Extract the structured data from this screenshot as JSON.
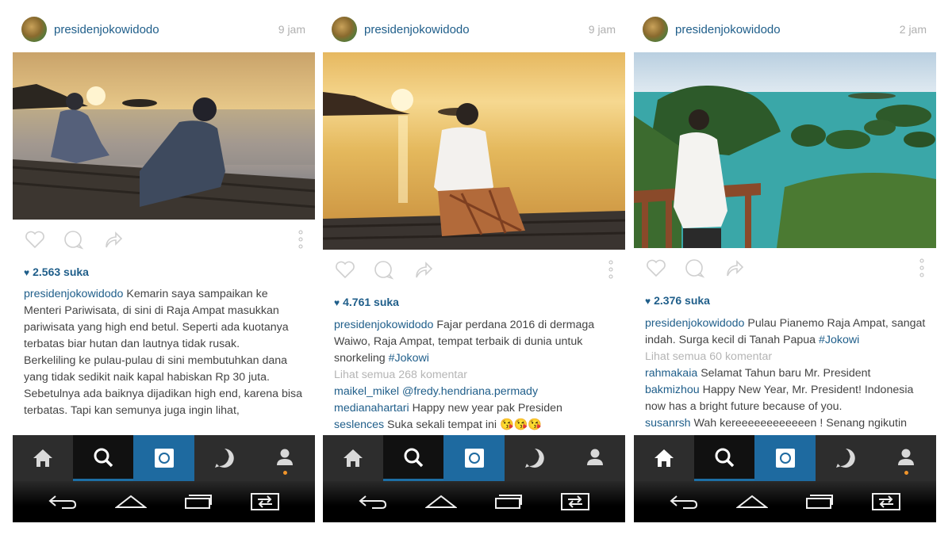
{
  "posts": [
    {
      "username": "presidenjokowidodo",
      "time": "9 jam",
      "likes": "2.563 suka",
      "caption": "Kemarin saya sampaikan ke Menteri Pariwisata, di sini di Raja Ampat masukkan pariwisata yang high end betul. Seperti ada kuotanya terbatas biar hutan dan lautnya tidak rusak.",
      "caption2": "Berkeliling ke pulau-pulau di sini membutuhkan dana yang tidak sedikit naik kapal habiskan Rp 30 juta. Sebetulnya ada baiknya dijadikan high end, karena bisa terbatas. Tapi kan semunya juga ingin lihat,"
    },
    {
      "username": "presidenjokowidodo",
      "time": "9 jam",
      "likes": "4.761 suka",
      "caption": "Fajar perdana 2016 di dermaga Waiwo, Raja Ampat, tempat terbaik di dunia untuk snorkeling",
      "hashtag": "#Jokowi",
      "see_all": "Lihat semua 268 komentar",
      "comments": [
        {
          "user": "maikel_mikel",
          "text": "@fredy.hendriana.permady"
        },
        {
          "user": "medianahartari",
          "text": "Happy new year pak Presiden"
        },
        {
          "user": "seslences",
          "text": "Suka sekali tempat ini 😘😘😘"
        }
      ]
    },
    {
      "username": "presidenjokowidodo",
      "time": "2 jam",
      "likes": "2.376 suka",
      "caption": "Pulau Pianemo Raja Ampat, sangat indah. Surga kecil di Tanah Papua",
      "hashtag": "#Jokowi",
      "see_all": "Lihat semua 60 komentar",
      "comments": [
        {
          "user": "rahmakaia",
          "text": "Selamat Tahun baru Mr. President"
        },
        {
          "user": "bakmizhou",
          "text": "Happy New Year, Mr. President! Indonesia now has a bright future because of you."
        },
        {
          "user": "susanrsh",
          "text": "Wah kereeeeeeeeeeeen ! Senang ngikutin"
        }
      ]
    }
  ],
  "tabs": [
    "home-icon",
    "search-icon",
    "camera-icon",
    "activity-heart-icon",
    "profile-icon"
  ],
  "nav": [
    "back-icon",
    "home-nav-icon",
    "recents-icon",
    "switch-app-icon"
  ],
  "colors": {
    "accent": "#1f5e8a",
    "tab_active": "#1e6aa0",
    "notification": "#f0942a"
  }
}
